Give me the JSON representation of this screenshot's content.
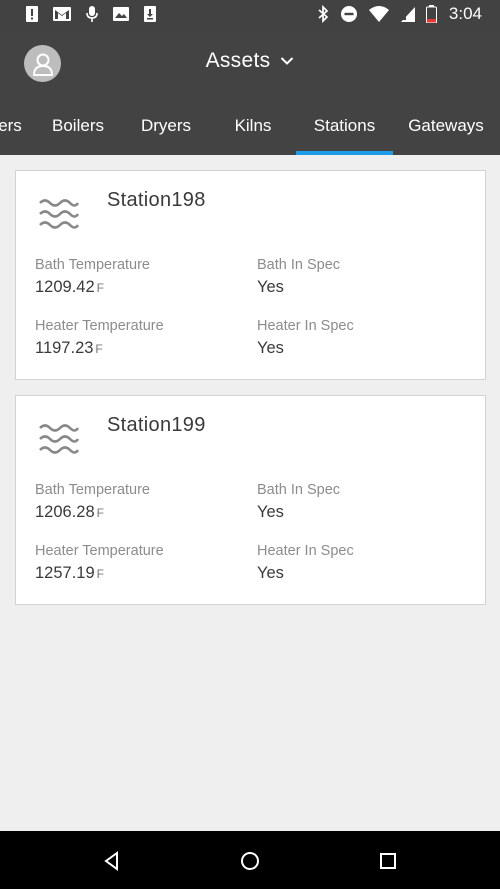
{
  "status_bar": {
    "time": "3:04",
    "left_icons": [
      "alert-icon",
      "gmail-icon",
      "microphone-icon",
      "image-icon",
      "download-icon"
    ],
    "right_icons": [
      "bluetooth-icon",
      "do-not-disturb-icon",
      "wifi-icon",
      "signal-icon",
      "battery-icon"
    ]
  },
  "app_bar": {
    "title": "Assets",
    "avatar_icon": "user-icon",
    "dropdown_icon": "chevron-down-icon"
  },
  "tabs": [
    {
      "label": "ers"
    },
    {
      "label": "Boilers"
    },
    {
      "label": "Dryers"
    },
    {
      "label": "Kilns"
    },
    {
      "label": "Stations",
      "selected": true
    },
    {
      "label": "Gateways"
    }
  ],
  "colors": {
    "app_bar": "#434343",
    "status_bar": "#424242",
    "tab_indicator": "#1e9be9",
    "background": "#efefef"
  },
  "cards": [
    {
      "name": "Station198",
      "icon": "waves-icon",
      "bath_temp_label": "Bath Temperature",
      "bath_temp_value": "1209.42",
      "bath_temp_unit": "F",
      "bath_spec_label": "Bath In Spec",
      "bath_spec_value": "Yes",
      "heater_temp_label": "Heater Temperature",
      "heater_temp_value": "1197.23",
      "heater_temp_unit": "F",
      "heater_spec_label": "Heater In Spec",
      "heater_spec_value": "Yes"
    },
    {
      "name": "Station199",
      "icon": "waves-icon",
      "bath_temp_label": "Bath Temperature",
      "bath_temp_value": "1206.28",
      "bath_temp_unit": "F",
      "bath_spec_label": "Bath In Spec",
      "bath_spec_value": "Yes",
      "heater_temp_label": "Heater Temperature",
      "heater_temp_value": "1257.19",
      "heater_temp_unit": "F",
      "heater_spec_label": "Heater In Spec",
      "heater_spec_value": "Yes"
    }
  ],
  "nav_bar": {
    "buttons": [
      "back-icon",
      "home-icon",
      "recents-icon"
    ]
  }
}
